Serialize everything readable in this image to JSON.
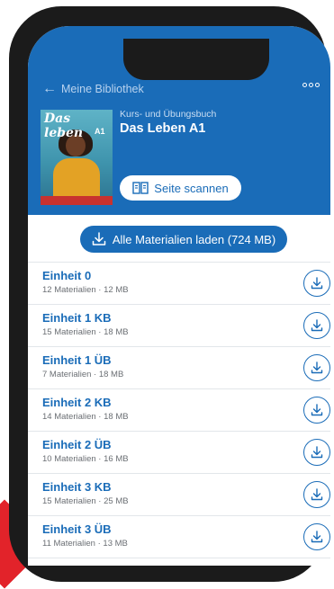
{
  "nav": {
    "back_label": "Meine Bibliothek"
  },
  "book": {
    "cover_title": "Das leben",
    "cover_level": "A1",
    "subtitle": "Kurs- und Übungsbuch",
    "title": "Das Leben A1",
    "scan_label": "Seite scannen"
  },
  "actions": {
    "load_all_label": "Alle Materialien laden (724 MB)"
  },
  "units": [
    {
      "title": "Einheit 0",
      "meta": "12 Materialien · 12 MB"
    },
    {
      "title": "Einheit 1 KB",
      "meta": "15 Materialien · 18 MB"
    },
    {
      "title": "Einheit 1 ÜB",
      "meta": "7 Materialien · 18 MB"
    },
    {
      "title": "Einheit 2 KB",
      "meta": "14 Materialien · 18 MB"
    },
    {
      "title": "Einheit 2 ÜB",
      "meta": "10 Materialien · 16 MB"
    },
    {
      "title": "Einheit 3 KB",
      "meta": "15 Materialien · 25 MB"
    },
    {
      "title": "Einheit 3 ÜB",
      "meta": "11 Materialien · 13 MB"
    }
  ],
  "colors": {
    "brand_blue": "#1a6cb8",
    "accent_red": "#e2232a"
  },
  "icons": {
    "back": "arrow-left-icon",
    "menu": "more-dots-icon",
    "scan": "book-scan-icon",
    "download": "download-icon"
  }
}
